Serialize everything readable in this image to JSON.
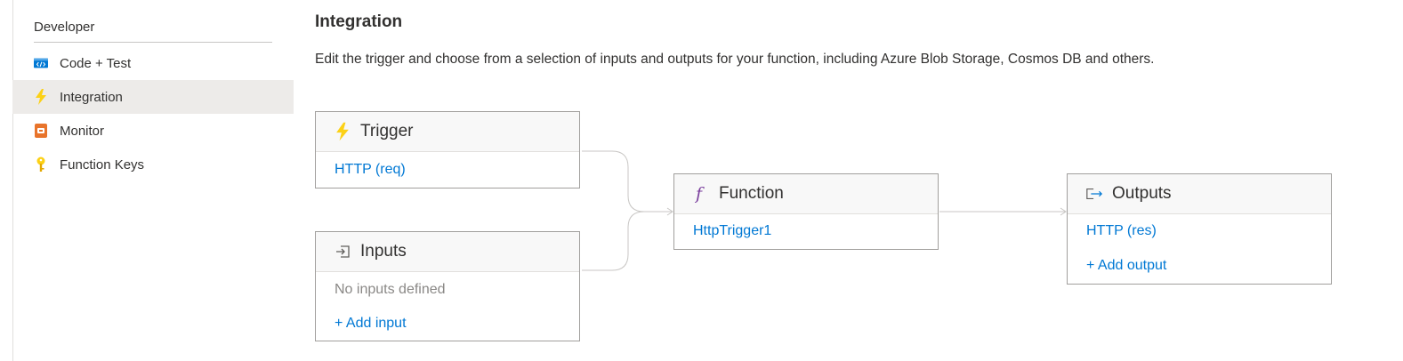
{
  "sidebar": {
    "header": "Developer",
    "items": [
      {
        "label": "Code + Test",
        "icon": "code-icon",
        "selected": false
      },
      {
        "label": "Integration",
        "icon": "lightning-icon",
        "selected": true
      },
      {
        "label": "Monitor",
        "icon": "monitor-icon",
        "selected": false
      },
      {
        "label": "Function Keys",
        "icon": "key-icon",
        "selected": false
      }
    ]
  },
  "main": {
    "title": "Integration",
    "description": "Edit the trigger and choose from a selection of inputs and outputs for your function, including Azure Blob Storage, Cosmos DB and others."
  },
  "diagram": {
    "trigger": {
      "title": "Trigger",
      "icon": "lightning-icon",
      "link": "HTTP (req)"
    },
    "inputs": {
      "title": "Inputs",
      "icon": "input-icon",
      "empty_text": "No inputs defined",
      "add_label": "+ Add input"
    },
    "function": {
      "title": "Function",
      "icon": "function-icon",
      "link": "HttpTrigger1"
    },
    "outputs": {
      "title": "Outputs",
      "icon": "output-icon",
      "link": "HTTP (res)",
      "add_label": "+ Add output"
    }
  },
  "colors": {
    "accent": "#0078d4",
    "lightning": "#fcd116",
    "function_icon": "#7a3e9d",
    "monitor": "#e8742b",
    "selected_bg": "#edebe9"
  }
}
